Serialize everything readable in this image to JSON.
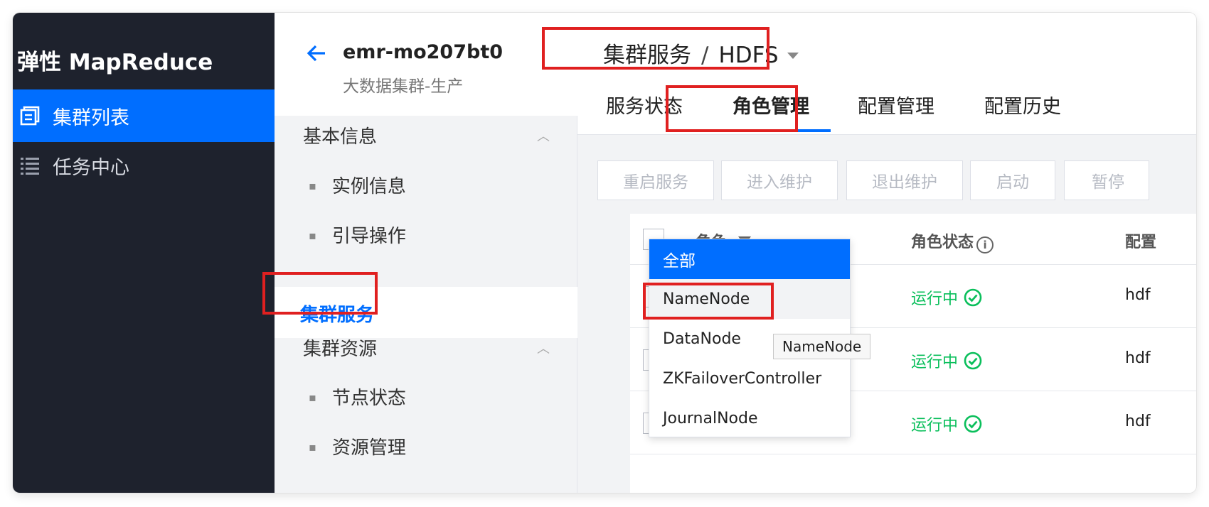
{
  "leftnav": {
    "brand": "弹性 MapReduce",
    "items": [
      {
        "label": "集群列表",
        "icon": "cluster-list-icon",
        "active": true
      },
      {
        "label": "任务中心",
        "icon": "task-list-icon",
        "active": false
      }
    ]
  },
  "subnav": {
    "back_icon": "arrow-left-icon",
    "cluster_id": "emr-mo207bt0",
    "cluster_name": "大数据集群-生产",
    "groups": [
      {
        "label": "基本信息",
        "items": [
          "实例信息",
          "引导操作"
        ]
      },
      {
        "label": "集群服务",
        "active": true
      },
      {
        "label": "集群资源",
        "items": [
          "节点状态",
          "资源管理"
        ]
      }
    ]
  },
  "header": {
    "breadcrumb_root": "集群服务",
    "separator": "/",
    "service": "HDFS",
    "tabs": [
      "服务状态",
      "角色管理",
      "配置管理",
      "配置历史"
    ],
    "active_tab": "角色管理"
  },
  "toolbar": {
    "buttons": [
      "重启服务",
      "进入维护",
      "退出维护",
      "启动",
      "暂停"
    ]
  },
  "table": {
    "columns": [
      "角色",
      "角色状态",
      "配置"
    ],
    "rows": [
      {
        "status": "运行中",
        "config": "hdf"
      },
      {
        "status": "运行中",
        "config": "hdf"
      },
      {
        "status": "运行中",
        "config": "hdf"
      }
    ]
  },
  "role_filter": {
    "options": [
      "全部",
      "NameNode",
      "DataNode",
      "ZKFailoverController",
      "JournalNode"
    ],
    "selected": "全部",
    "hovered": "NameNode",
    "tooltip": "NameNode"
  },
  "colors": {
    "accent": "#006eff",
    "nav_bg": "#1e222d",
    "running": "#0abf5b",
    "highlight": "#e02020"
  }
}
